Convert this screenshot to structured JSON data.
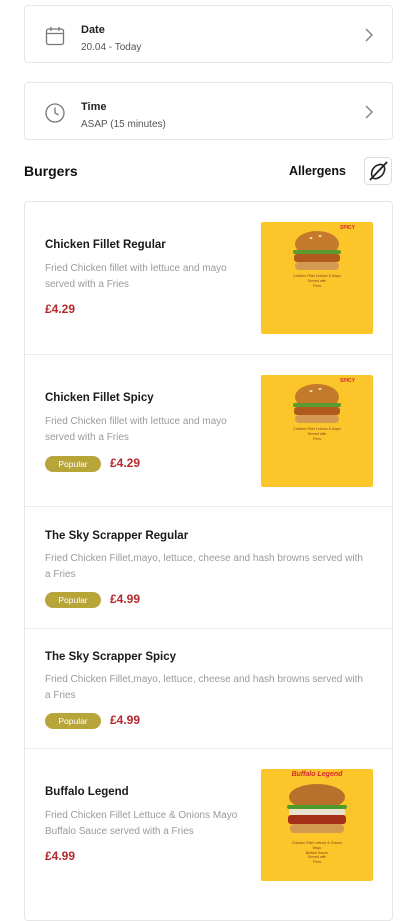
{
  "date_selector": {
    "title": "Date",
    "value": "20.04 - Today",
    "icon": "calendar-icon"
  },
  "time_selector": {
    "title": "Time",
    "value": "ASAP (15 minutes)",
    "icon": "clock-icon"
  },
  "section": {
    "title": "Burgers",
    "allergens_label": "Allergens",
    "allergens_icon": "allergens-icon"
  },
  "colors": {
    "price": "#b3282d",
    "badge": "#b7a53a",
    "thumbnail_bg": "#fcc62b"
  },
  "items": [
    {
      "name": "Chicken Fillet Regular",
      "description": "Fried Chicken fillet with lettuce and mayo served with a Fries",
      "price": "£4.29",
      "badge": "",
      "has_image": true
    },
    {
      "name": "Chicken Fillet Spicy",
      "description": "Fried Chicken fillet with lettuce and mayo served with a Fries",
      "price": "£4.29",
      "badge": "Popular",
      "has_image": true
    },
    {
      "name": "The Sky Scrapper Regular",
      "description": "Fried Chicken Fillet,mayo, lettuce, cheese and hash browns served with a Fries",
      "price": "£4.99",
      "badge": "Popular",
      "has_image": false
    },
    {
      "name": "The Sky Scrapper Spicy",
      "description": "Fried Chicken Fillet,mayo, lettuce, cheese and hash browns served with a Fries",
      "price": "£4.99",
      "badge": "Popular",
      "has_image": false
    },
    {
      "name": "Buffalo Legend",
      "description": "Fried Chicken Fillet Lettuce & Onions Mayo Buffalo Sauce served with a Fries",
      "price": "£4.99",
      "badge": "",
      "has_image": true
    }
  ]
}
